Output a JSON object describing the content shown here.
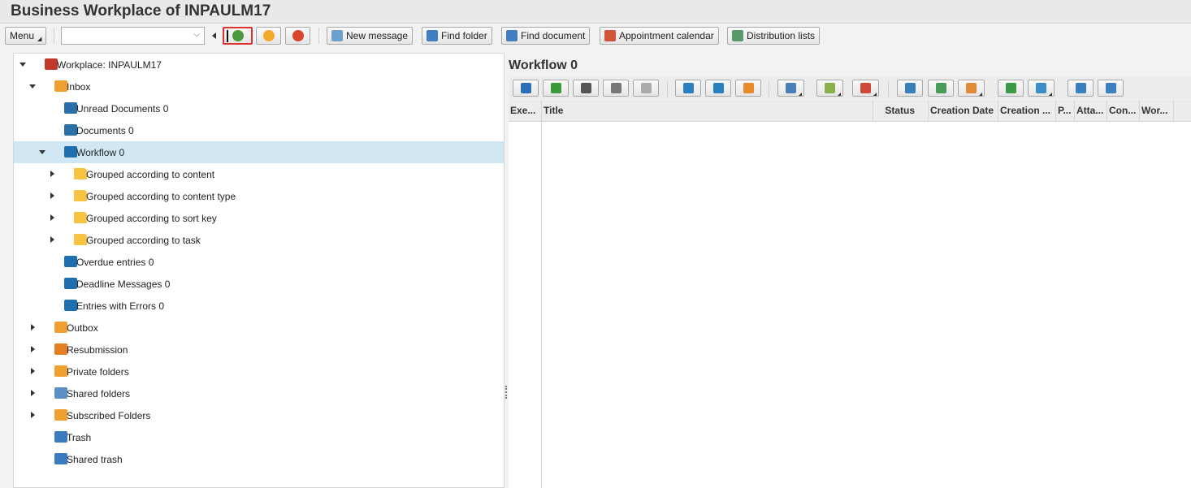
{
  "window": {
    "title": "Business Workplace of INPAULM17"
  },
  "toolbar": {
    "menu": "Menu",
    "combo_value": "",
    "new_message": "New message",
    "find_folder": "Find folder",
    "find_document": "Find document",
    "appointment_calendar": "Appointment calendar",
    "distribution_lists": "Distribution lists"
  },
  "tree": [
    {
      "label": "Workplace: INPAULM17",
      "level": 0,
      "expand": "down",
      "icon": "workplace-chair-icon",
      "color": "#c0392b"
    },
    {
      "label": "Inbox",
      "level": 1,
      "expand": "down",
      "icon": "inbox-tray-icon",
      "color": "#f0a030"
    },
    {
      "label": "Unread Documents 0",
      "level": 2,
      "expand": "none",
      "icon": "document-icon",
      "color": "#2a6fa8"
    },
    {
      "label": "Documents 0",
      "level": 2,
      "expand": "none",
      "icon": "document-icon",
      "color": "#2a6fa8"
    },
    {
      "label": "Workflow 0",
      "level": 2,
      "expand": "down",
      "icon": "workflow-icon",
      "color": "#1e6fb0",
      "selected": true
    },
    {
      "label": "Grouped according to content",
      "level": 3,
      "expand": "right",
      "icon": "folder-icon",
      "color": "#f6c343"
    },
    {
      "label": "Grouped according to content type",
      "level": 3,
      "expand": "right",
      "icon": "folder-icon",
      "color": "#f6c343"
    },
    {
      "label": "Grouped according to sort key",
      "level": 3,
      "expand": "right",
      "icon": "folder-icon",
      "color": "#f6c343"
    },
    {
      "label": "Grouped according to task",
      "level": 3,
      "expand": "right",
      "icon": "folder-icon",
      "color": "#f6c343"
    },
    {
      "label": "Overdue entries 0",
      "level": 2,
      "expand": "none",
      "icon": "workflow-icon",
      "color": "#1e6fb0"
    },
    {
      "label": "Deadline Messages 0",
      "level": 2,
      "expand": "none",
      "icon": "workflow-icon",
      "color": "#1e6fb0"
    },
    {
      "label": "Entries with Errors 0",
      "level": 2,
      "expand": "none",
      "icon": "workflow-icon",
      "color": "#1e6fb0"
    },
    {
      "label": "Outbox",
      "level": 1,
      "expand": "right",
      "icon": "outbox-tray-icon",
      "color": "#f0a030"
    },
    {
      "label": "Resubmission",
      "level": 1,
      "expand": "right",
      "icon": "resubmission-icon",
      "color": "#e67e22"
    },
    {
      "label": "Private folders",
      "level": 1,
      "expand": "right",
      "icon": "private-folder-icon",
      "color": "#f0a030"
    },
    {
      "label": "Shared folders",
      "level": 1,
      "expand": "right",
      "icon": "shared-folder-icon",
      "color": "#5a8fc8"
    },
    {
      "label": "Subscribed Folders",
      "level": 1,
      "expand": "right",
      "icon": "subscribed-folder-icon",
      "color": "#f0a030"
    },
    {
      "label": "Trash",
      "level": 1,
      "expand": "none",
      "icon": "trash-icon",
      "color": "#3b7bbf"
    },
    {
      "label": "Shared trash",
      "level": 1,
      "expand": "none",
      "icon": "trash-icon",
      "color": "#3b7bbf"
    }
  ],
  "content": {
    "title": "Workflow 0",
    "columns": [
      "Exe...",
      "Title",
      "Status",
      "Creation Date",
      "Creation ...",
      "P...",
      "Atta...",
      "Con...",
      "Wor..."
    ],
    "rows": []
  },
  "colors": {
    "selected_row": "#d1e8f4",
    "highlight_border": "#e03030"
  }
}
